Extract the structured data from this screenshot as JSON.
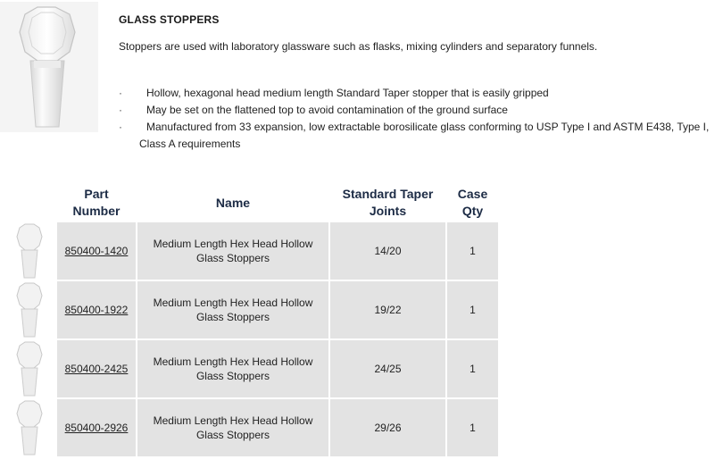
{
  "product": {
    "title": "GLASS STOPPERS",
    "description": "Stoppers are used with laboratory glassware such as flasks, mixing cylinders and separatory funnels.",
    "bullets": [
      "Hollow, hexagonal head medium length Standard Taper stopper that is easily gripped",
      "May be set on the flattened top to avoid contamination of the ground surface",
      "Manufactured from 33 expansion, low extractable borosilicate glass conforming to USP Type I and ASTM E438, Type I,"
    ],
    "bullet_continuation": "Class A requirements",
    "bullet_glyph": "·"
  },
  "table": {
    "headers": {
      "part_number": "Part Number",
      "name": "Name",
      "joints": "Standard Taper Joints",
      "case_qty": "Case Qty"
    },
    "rows": [
      {
        "part": "850400-1420",
        "name": "Medium Length Hex Head Hollow Glass Stoppers",
        "joints": "14/20",
        "qty": "1"
      },
      {
        "part": "850400-1922",
        "name": "Medium Length Hex Head Hollow Glass Stoppers",
        "joints": "19/22",
        "qty": "1"
      },
      {
        "part": "850400-2425",
        "name": "Medium Length Hex Head Hollow Glass Stoppers",
        "joints": "24/25",
        "qty": "1"
      },
      {
        "part": "850400-2926",
        "name": "Medium Length Hex Head Hollow Glass Stoppers",
        "joints": "29/26",
        "qty": "1"
      }
    ]
  },
  "colors": {
    "header_text": "#1c2b45",
    "cell_background": "#e3e3e3"
  }
}
